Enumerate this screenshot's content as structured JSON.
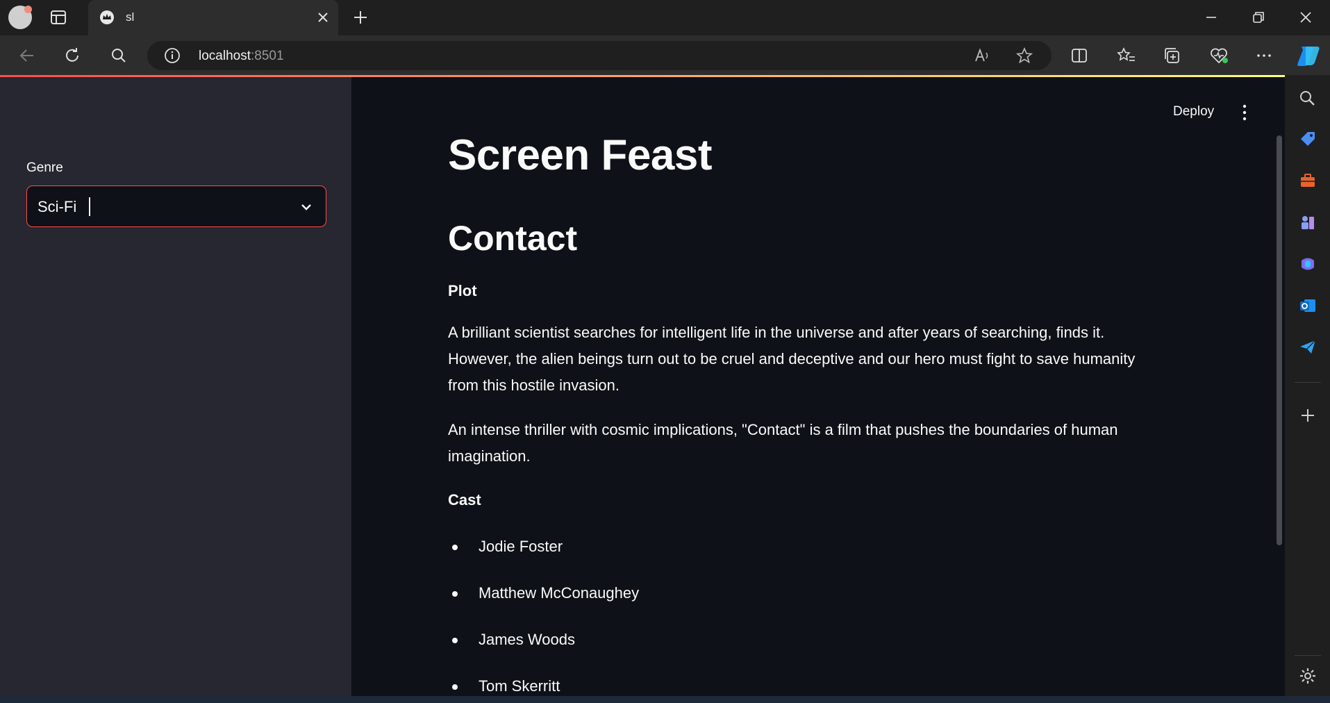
{
  "browser": {
    "tab_title": "sl",
    "url_host": "localhost",
    "url_port": ":8501"
  },
  "sidebar": {
    "genre_label": "Genre",
    "genre_value": "Sci-Fi"
  },
  "header": {
    "deploy_label": "Deploy"
  },
  "main": {
    "app_title": "Screen Feast",
    "movie_title": "Contact",
    "plot_heading": "Plot",
    "plot_paragraph_1": "A brilliant scientist searches for intelligent life in the universe and after years of searching, finds it. However, the alien beings turn out to be cruel and deceptive and our hero must fight to save humanity from this hostile invasion.",
    "plot_paragraph_2": "An intense thriller with cosmic implications, \"Contact\" is a film that pushes the boundaries of human imagination.",
    "cast_heading": "Cast",
    "cast": [
      "Jodie Foster",
      "Matthew McConaughey",
      "James Woods",
      "Tom Skerritt"
    ]
  },
  "colors": {
    "accent": "#ff4b4b",
    "app_background": "#0e1117",
    "sidebar_background": "#262730",
    "text": "#fafafa"
  }
}
